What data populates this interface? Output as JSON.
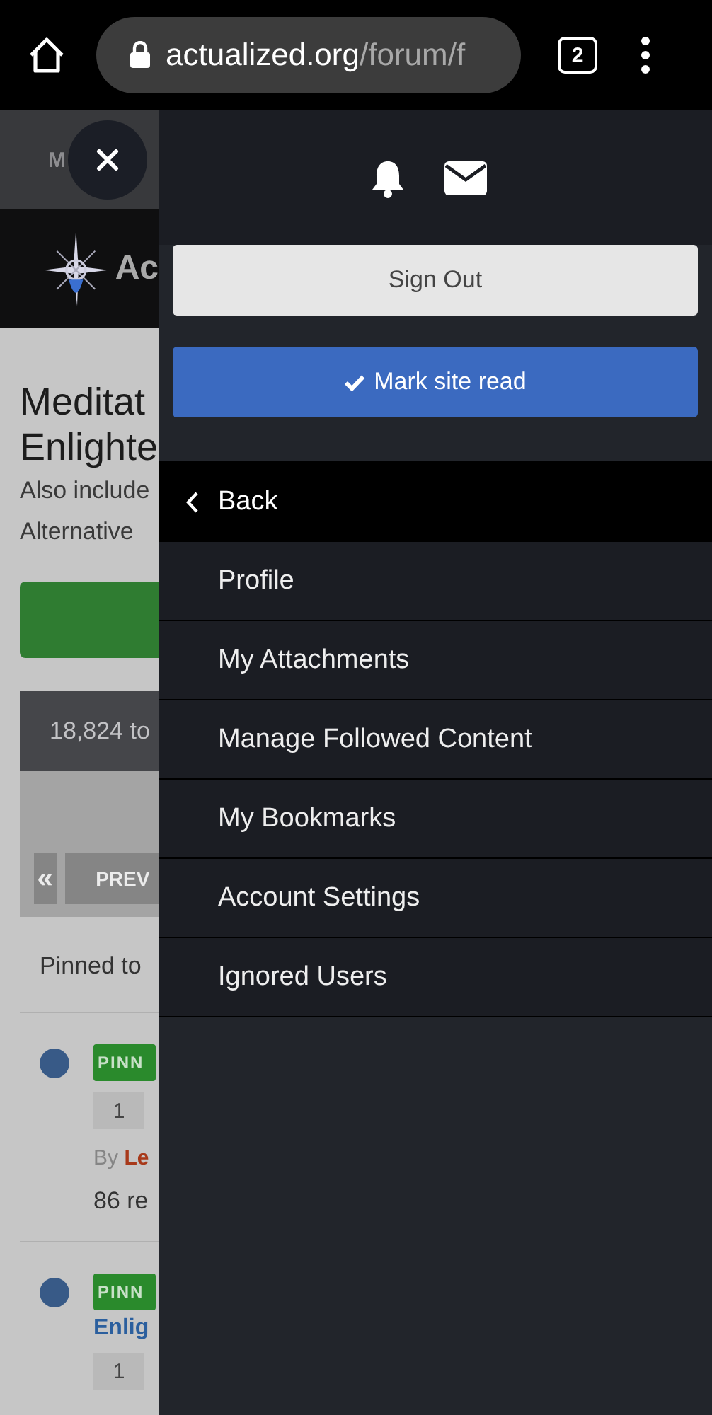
{
  "browser": {
    "url_host": "actualized.org",
    "url_path": "/forum/f",
    "tab_count": "2"
  },
  "page": {
    "nav_text": "M",
    "logo_text": "Ac",
    "title_lines": [
      "Meditat",
      "Enlighte"
    ],
    "description_lines": [
      "Also include",
      "Alternative"
    ],
    "topic_count": "18,824 to",
    "first_page": "«",
    "prev_page": "PREV",
    "pinned_heading": "Pinned to",
    "topics": [
      {
        "badge": "PINN",
        "page": "1",
        "by": "By",
        "author": "Le",
        "replies": "86 re"
      },
      {
        "badge": "PINN",
        "title": "Enlig",
        "page": "1"
      }
    ]
  },
  "drawer": {
    "sign_out": "Sign Out",
    "mark_read": "Mark site read",
    "back": "Back",
    "menu": [
      "Profile",
      "My Attachments",
      "Manage Followed Content",
      "My Bookmarks",
      "Account Settings",
      "Ignored Users"
    ]
  }
}
